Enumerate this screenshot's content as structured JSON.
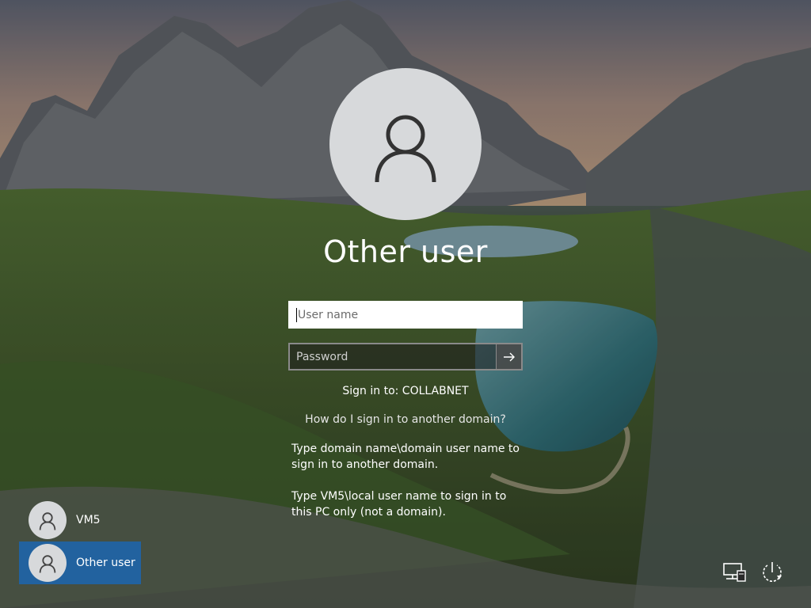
{
  "user": {
    "title": "Other user"
  },
  "form": {
    "username_placeholder": "User name",
    "password_placeholder": "Password",
    "submit_icon": "arrow-right-icon"
  },
  "signin": {
    "target": "Sign in to: COLLABNET",
    "domain_link": "How do I sign in to another domain?",
    "help_line_1": "Type domain name\\domain user name to sign in to another domain.",
    "help_line_2": "Type VM5\\local user name to sign in to this PC only (not a domain)."
  },
  "users": [
    {
      "label": "VM5",
      "icon": "user-icon",
      "selected": false
    },
    {
      "label": "Other user",
      "icon": "user-icon",
      "selected": true
    }
  ],
  "tray": {
    "network_icon": "network-icon",
    "power_icon": "power-icon"
  },
  "colors": {
    "selected_user_bg": "#1e64aa",
    "avatar_bg": "#d7d9db"
  }
}
